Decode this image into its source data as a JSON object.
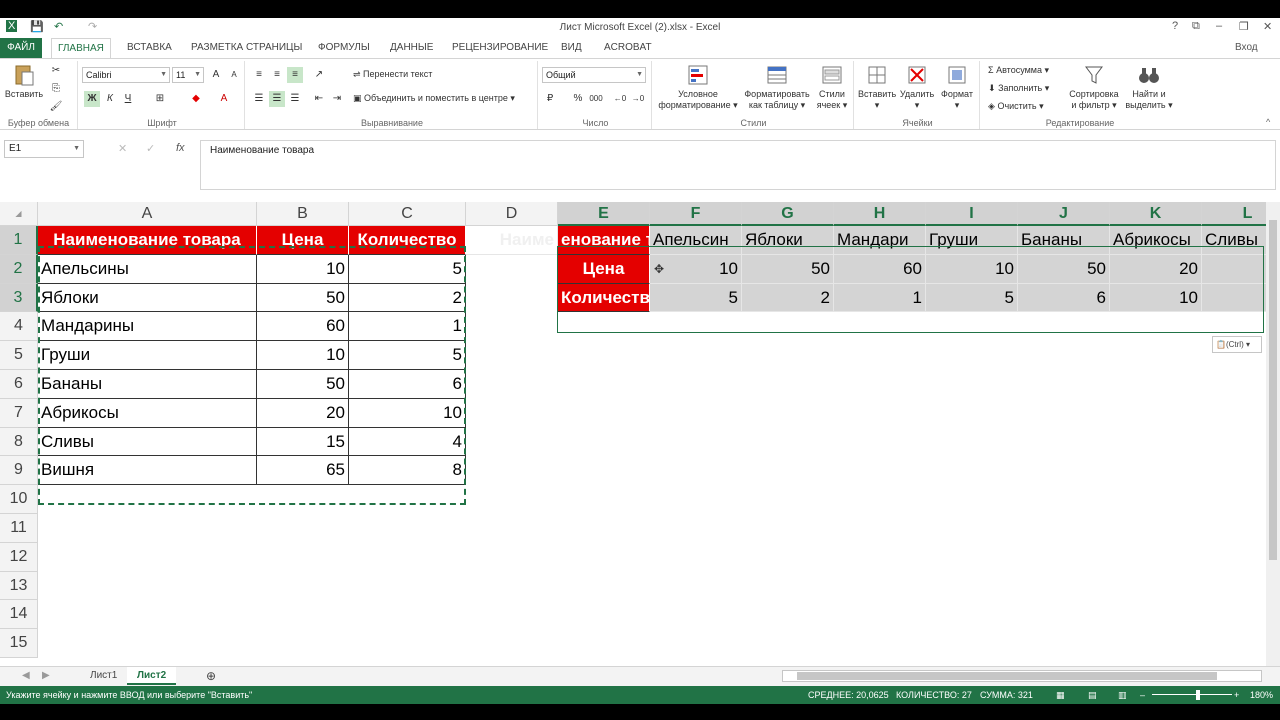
{
  "window": {
    "title": "Лист Microsoft Excel (2).xlsx - Excel",
    "controls": [
      "?",
      "⧉",
      "–",
      "❐",
      "✕"
    ],
    "user": "Вход"
  },
  "tabs": [
    "ФАЙЛ",
    "ГЛАВНАЯ",
    "ВСТАВКА",
    "РАЗМЕТКА СТРАНИЦЫ",
    "ФОРМУЛЫ",
    "ДАННЫЕ",
    "РЕЦЕНЗИРОВАНИЕ",
    "ВИД",
    "ACROBAT"
  ],
  "ribbon": {
    "clipboard": {
      "paste": "Вставить",
      "label": "Буфер обмена"
    },
    "font": {
      "name": "Calibri",
      "size": "11",
      "bold": "Ж",
      "italic": "К",
      "underline": "Ч",
      "grow": "A",
      "shrink": "A",
      "label": "Шрифт"
    },
    "align": {
      "wrap": "Перенести текст",
      "merge": "Объединить и поместить в центре",
      "label": "Выравнивание"
    },
    "number": {
      "format": "Общий",
      "percent": "%",
      "thousands": "000",
      "label": "Число"
    },
    "styles": {
      "cond1": "Условное",
      "cond2": "форматирование",
      "table1": "Форматировать",
      "table2": "как таблицу",
      "cell1": "Стили",
      "cell2": "ячеек",
      "label": "Стили"
    },
    "cells": {
      "insert": "Вставить",
      "delete": "Удалить",
      "format": "Формат",
      "label": "Ячейки"
    },
    "edit": {
      "autosum": "Автосумма",
      "fill": "Заполнить",
      "clear": "Очистить",
      "sort1": "Сортировка",
      "sort2": "и фильтр",
      "find1": "Найти и",
      "find2": "выделить",
      "label": "Редактирование"
    }
  },
  "formula_bar": {
    "namebox": "E1",
    "fx": "fx",
    "content": "Наименование товара"
  },
  "columns": [
    "A",
    "B",
    "C",
    "D",
    "E",
    "F",
    "G",
    "H",
    "I",
    "J",
    "K",
    "L"
  ],
  "rows": [
    "1",
    "2",
    "3",
    "4",
    "5",
    "6",
    "7",
    "8",
    "9",
    "10",
    "11",
    "12",
    "13",
    "14",
    "15"
  ],
  "source_table": {
    "headers": [
      "Наименование товара",
      "Цена",
      "Количество"
    ],
    "rows": [
      [
        "Апельсины",
        "10",
        "5"
      ],
      [
        "Яблоки",
        "50",
        "2"
      ],
      [
        "Мандарины",
        "60",
        "1"
      ],
      [
        "Груши",
        "10",
        "5"
      ],
      [
        "Бананы",
        "50",
        "6"
      ],
      [
        "Абрикосы",
        "20",
        "10"
      ],
      [
        "Сливы",
        "15",
        "4"
      ],
      [
        "Вишня",
        "65",
        "8"
      ]
    ]
  },
  "ghost_d1": "Наиме",
  "transposed": {
    "labels": [
      "енование т",
      "Цена",
      "Количеств"
    ],
    "products": [
      "Апельсин",
      "Яблоки",
      "Мандари",
      "Груши",
      "Бананы",
      "Абрикосы",
      "Сливы"
    ],
    "prices": [
      "10",
      "50",
      "60",
      "10",
      "50",
      "20",
      ""
    ],
    "quantities": [
      "5",
      "2",
      "1",
      "5",
      "6",
      "10",
      ""
    ]
  },
  "paste_options": "(Ctrl) ▾",
  "sheets": [
    "Лист1",
    "Лист2"
  ],
  "status": {
    "message": "Укажите ячейку и нажмите ВВОД или выберите \"Вставить\"",
    "average": "СРЕДНЕЕ: 20,0625",
    "count": "КОЛИЧЕСТВО: 27",
    "sum": "СУММА: 321",
    "zoom": "180%"
  },
  "colors": {
    "accent": "#217346",
    "header_red": "#e40000"
  }
}
